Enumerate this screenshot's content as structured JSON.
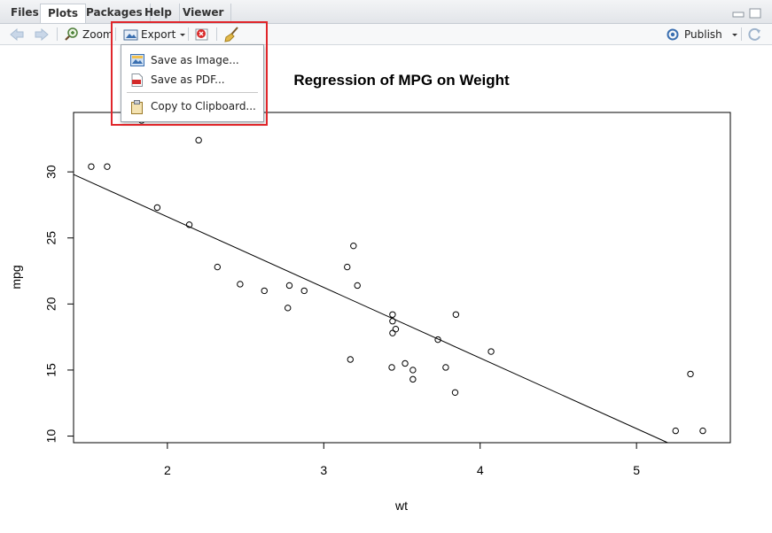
{
  "tabs": [
    {
      "label": "Files"
    },
    {
      "label": "Plots"
    },
    {
      "label": "Packages"
    },
    {
      "label": "Help"
    },
    {
      "label": "Viewer"
    }
  ],
  "toolbar": {
    "zoom_label": "Zoom",
    "export_label": "Export",
    "publish_label": "Publish"
  },
  "export_menu": {
    "items": [
      {
        "label": "Save as Image...",
        "icon": "image-icon"
      },
      {
        "label": "Save as PDF...",
        "icon": "pdf-icon"
      },
      {
        "label": "Copy to Clipboard...",
        "icon": "clipboard-icon"
      }
    ]
  },
  "colors": {
    "highlight": "#e0262b",
    "accent": "#3a6fb0"
  },
  "chart_data": {
    "type": "scatter",
    "title": "Regression of MPG on Weight",
    "xlabel": "wt",
    "ylabel": "mpg",
    "xlim": [
      1.4,
      5.6
    ],
    "ylim": [
      9.5,
      34.5
    ],
    "xticks": [
      "2",
      "3",
      "4",
      "5"
    ],
    "yticks": [
      "10",
      "15",
      "20",
      "25",
      "30"
    ],
    "points": [
      [
        2.62,
        21.0
      ],
      [
        2.875,
        21.0
      ],
      [
        2.32,
        22.8
      ],
      [
        3.215,
        21.4
      ],
      [
        3.44,
        18.7
      ],
      [
        3.46,
        18.1
      ],
      [
        3.57,
        14.3
      ],
      [
        3.19,
        24.4
      ],
      [
        3.15,
        22.8
      ],
      [
        3.44,
        19.2
      ],
      [
        3.44,
        17.8
      ],
      [
        4.07,
        16.4
      ],
      [
        3.73,
        17.3
      ],
      [
        3.78,
        15.2
      ],
      [
        5.25,
        10.4
      ],
      [
        5.424,
        10.4
      ],
      [
        5.345,
        14.7
      ],
      [
        2.2,
        32.4
      ],
      [
        1.615,
        30.4
      ],
      [
        1.835,
        33.9
      ],
      [
        2.465,
        21.5
      ],
      [
        3.52,
        15.5
      ],
      [
        3.435,
        15.2
      ],
      [
        3.84,
        13.3
      ],
      [
        3.845,
        19.2
      ],
      [
        1.935,
        27.3
      ],
      [
        2.14,
        26.0
      ],
      [
        1.513,
        30.4
      ],
      [
        3.17,
        15.8
      ],
      [
        2.77,
        19.7
      ],
      [
        3.57,
        15.0
      ],
      [
        2.78,
        21.4
      ]
    ],
    "regression": {
      "intercept": 37.285,
      "slope": -5.344
    },
    "grid": false
  }
}
